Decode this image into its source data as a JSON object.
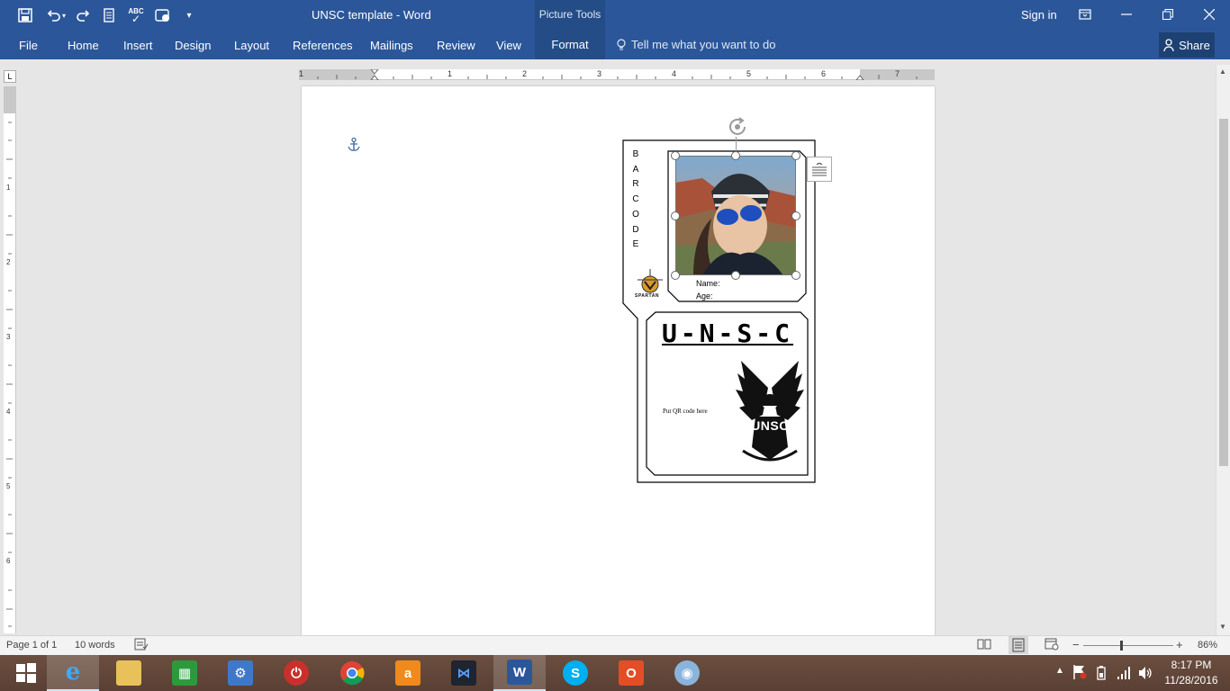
{
  "window": {
    "title": "UNSC template - Word",
    "contextual_group": "Picture Tools",
    "sign_in": "Sign in"
  },
  "ribbon": {
    "tabs": [
      "File",
      "Home",
      "Insert",
      "Design",
      "Layout",
      "References",
      "Mailings",
      "Review",
      "View",
      "Format"
    ],
    "active_tab": "Format",
    "tell_me": "Tell me what you want to do",
    "share": "Share"
  },
  "ruler": {
    "h_numbers": [
      "1",
      "1",
      "2",
      "3",
      "4",
      "5",
      "6",
      "7"
    ],
    "v_numbers": [
      "1",
      "2",
      "3",
      "4",
      "5",
      "6"
    ]
  },
  "document": {
    "barcode_letters": [
      "B",
      "A",
      "R",
      "C",
      "O",
      "D",
      "E"
    ],
    "name_label": "Name:",
    "age_label": "Age:",
    "unsc_title": "U-N-S-C",
    "qr_placeholder": "Put QR code here",
    "emblem_text": "UNSC",
    "spartan_text": "SPARTAN"
  },
  "status": {
    "page": "Page 1 of 1",
    "words": "10 words",
    "zoom": "86%"
  },
  "taskbar": {
    "time": "8:17 PM",
    "date": "11/28/2016"
  },
  "colors": {
    "word_blue": "#2b579a",
    "active_tab_bg": "#244d88",
    "taskbar_bg": "#5a4034"
  }
}
